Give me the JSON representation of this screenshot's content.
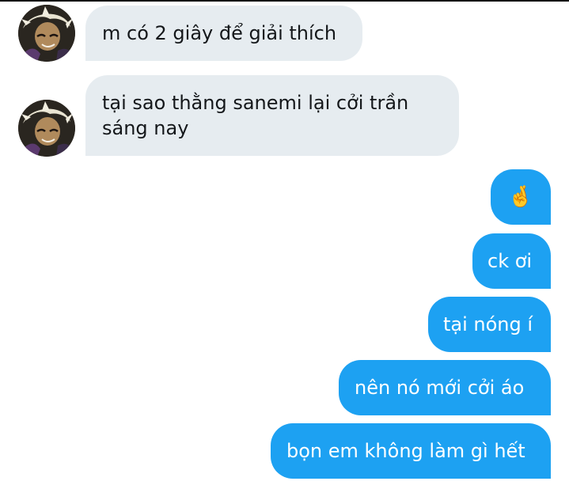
{
  "conversation": {
    "messages": [
      {
        "direction": "incoming",
        "text": "m có 2 giây để giải thích"
      },
      {
        "direction": "incoming",
        "text": "tại sao thằng sanemi lại cởi trần sáng nay"
      },
      {
        "direction": "outgoing",
        "text": "🤞"
      },
      {
        "direction": "outgoing",
        "text": "ck ơi"
      },
      {
        "direction": "outgoing",
        "text": "tại nóng í"
      },
      {
        "direction": "outgoing",
        "text": "nên nó mới cởi áo"
      },
      {
        "direction": "outgoing",
        "text": "bọn em không làm gì hết"
      }
    ]
  },
  "colors": {
    "incoming_bubble": "#e6ecf0",
    "outgoing_bubble": "#1da1f2",
    "incoming_text": "#14171a",
    "outgoing_text": "#ffffff"
  },
  "icons": {
    "avatar": "avatar-icon",
    "fingers_crossed": "fingers-crossed-emoji"
  }
}
